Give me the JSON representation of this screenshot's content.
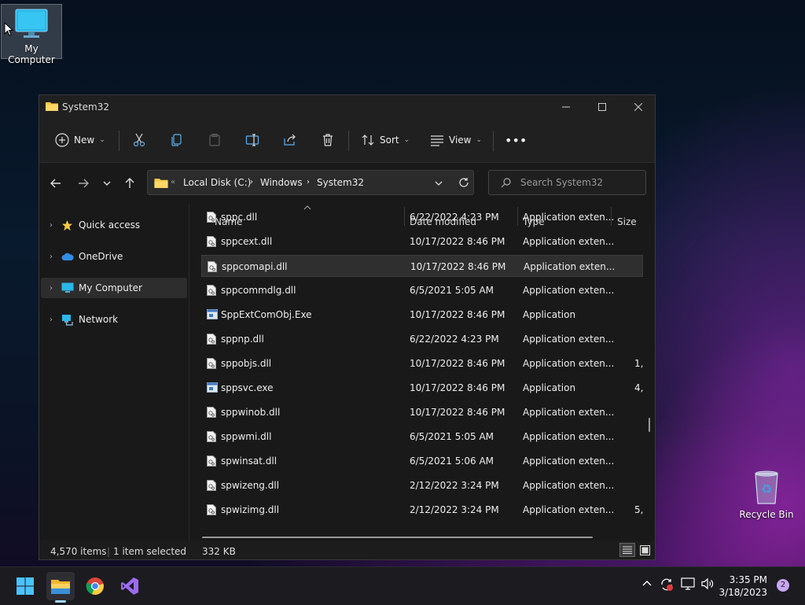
{
  "desktop": {
    "icons": [
      {
        "label": "My Computer"
      },
      {
        "label": "Recycle Bin"
      }
    ]
  },
  "window": {
    "title": "System32",
    "toolbar": {
      "new_label": "New",
      "sort_label": "Sort",
      "view_label": "View"
    },
    "address": {
      "overflow": "«",
      "crumbs": [
        "Local Disk (C:)",
        "Windows",
        "System32"
      ]
    },
    "search": {
      "placeholder": "Search System32"
    },
    "nav": [
      {
        "label": "Quick access"
      },
      {
        "label": "OneDrive"
      },
      {
        "label": "My Computer"
      },
      {
        "label": "Network"
      }
    ],
    "columns": [
      "Name",
      "Date modified",
      "Type",
      "Size"
    ],
    "files": [
      {
        "name": "sppc.dll",
        "date": "6/22/2022 4:23 PM",
        "type": "Application exten...",
        "size": "",
        "icon": "dll-icon"
      },
      {
        "name": "sppcext.dll",
        "date": "10/17/2022 8:46 PM",
        "type": "Application exten...",
        "size": "",
        "icon": "dll-icon"
      },
      {
        "name": "sppcomapi.dll",
        "date": "10/17/2022 8:46 PM",
        "type": "Application exten...",
        "size": "",
        "icon": "dll-icon"
      },
      {
        "name": "sppcommdlg.dll",
        "date": "6/5/2021 5:05 AM",
        "type": "Application exten...",
        "size": "",
        "icon": "dll-icon"
      },
      {
        "name": "SppExtComObj.Exe",
        "date": "10/17/2022 8:46 PM",
        "type": "Application",
        "size": "",
        "icon": "exe-icon"
      },
      {
        "name": "sppnp.dll",
        "date": "6/22/2022 4:23 PM",
        "type": "Application exten...",
        "size": "",
        "icon": "dll-icon"
      },
      {
        "name": "sppobjs.dll",
        "date": "10/17/2022 8:46 PM",
        "type": "Application exten...",
        "size": "1,",
        "icon": "dll-icon"
      },
      {
        "name": "sppsvc.exe",
        "date": "10/17/2022 8:46 PM",
        "type": "Application",
        "size": "4,",
        "icon": "exe-icon"
      },
      {
        "name": "sppwinob.dll",
        "date": "10/17/2022 8:46 PM",
        "type": "Application exten...",
        "size": "",
        "icon": "dll-icon"
      },
      {
        "name": "sppwmi.dll",
        "date": "6/5/2021 5:05 AM",
        "type": "Application exten...",
        "size": "",
        "icon": "dll-icon"
      },
      {
        "name": "spwinsat.dll",
        "date": "6/5/2021 5:06 AM",
        "type": "Application exten...",
        "size": "",
        "icon": "dll-icon"
      },
      {
        "name": "spwizeng.dll",
        "date": "2/12/2022 3:24 PM",
        "type": "Application exten...",
        "size": "",
        "icon": "dll-icon"
      },
      {
        "name": "spwizimg.dll",
        "date": "2/12/2022 3:24 PM",
        "type": "Application exten...",
        "size": "5,",
        "icon": "dll-icon"
      }
    ],
    "status": {
      "items": "4,570 items",
      "selected": "1 item selected",
      "size": "332 KB"
    }
  },
  "taskbar": {
    "time": "3:35 PM",
    "date": "3/18/2023",
    "notification_count": "2"
  }
}
